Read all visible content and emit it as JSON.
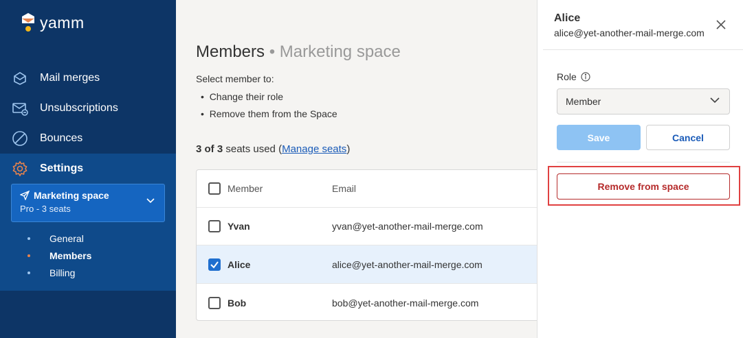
{
  "app": {
    "logo_text": "yamm"
  },
  "sidebar": {
    "nav": [
      {
        "label": "Mail merges",
        "icon": "mail-merge-icon"
      },
      {
        "label": "Unsubscriptions",
        "icon": "unsubscribe-mail-icon"
      },
      {
        "label": "Bounces",
        "icon": "bounce-icon"
      },
      {
        "label": "Settings",
        "icon": "gear-icon"
      }
    ],
    "space": {
      "name": "Marketing space",
      "plan": "Pro - 3 seats"
    },
    "sub_items": [
      {
        "label": "General",
        "active": false
      },
      {
        "label": "Members",
        "active": true
      },
      {
        "label": "Billing",
        "active": false
      }
    ]
  },
  "main": {
    "title": "Members",
    "title_sep": " • ",
    "title_sub": "Marketing space",
    "intro": "Select member to:",
    "bullets": [
      "Change their role",
      "Remove them from the Space"
    ],
    "seats_count": "3 of 3",
    "seats_suffix": " seats used",
    "seats_open": " (",
    "manage_link": "Manage seats",
    "seats_close": ")",
    "table": {
      "headers": {
        "member": "Member",
        "email": "Email"
      },
      "rows": [
        {
          "name": "Yvan",
          "email": "yvan@yet-another-mail-merge.com",
          "checked": false
        },
        {
          "name": "Alice",
          "email": "alice@yet-another-mail-merge.com",
          "checked": true
        },
        {
          "name": "Bob",
          "email": "bob@yet-another-mail-merge.com",
          "checked": false
        }
      ]
    }
  },
  "panel": {
    "name": "Alice",
    "email": "alice@yet-another-mail-merge.com",
    "role_label": "Role",
    "role_value": "Member",
    "save_label": "Save",
    "cancel_label": "Cancel",
    "remove_label": "Remove from space"
  },
  "colors": {
    "sidebar_bg": "#0d3566",
    "sidebar_active_bg": "#0f4a8a",
    "accent_orange": "#e8834c",
    "link_blue": "#1a5bb8",
    "danger_red": "#b52a2a"
  }
}
